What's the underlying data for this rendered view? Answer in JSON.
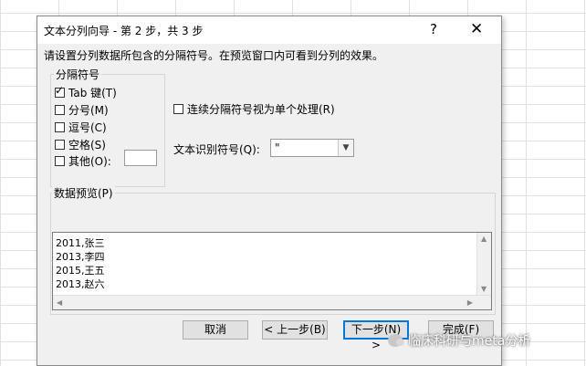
{
  "dialog": {
    "title": "文本分列向导 - 第 2 步，共 3 步",
    "help_label": "?",
    "close_label": "✕",
    "instruction": "请设置分列数据所包含的分隔符号。在预览窗口内可看到分列的效果。"
  },
  "delimiters": {
    "legend": "分隔符号",
    "items": [
      {
        "label": "Tab 键(T)",
        "checked": true
      },
      {
        "label": "分号(M)",
        "checked": false
      },
      {
        "label": "逗号(C)",
        "checked": false
      },
      {
        "label": "空格(S)",
        "checked": false
      },
      {
        "label": "其他(O):",
        "checked": false
      }
    ],
    "other_value": ""
  },
  "options": {
    "consecutive_label": "连续分隔符号视为单个处理(R)",
    "consecutive_checked": false,
    "qualifier_label": "文本识别符号(Q):",
    "qualifier_value": "\""
  },
  "preview": {
    "legend": "数据预览(P)",
    "lines": [
      "2011,张三",
      "2013,李四",
      "2015,王五",
      "2013,赵六"
    ]
  },
  "buttons": {
    "cancel": "取消",
    "back": "< 上一步(B)",
    "next": "下一步(N) >",
    "finish": "完成(F)"
  },
  "watermark": "临床科研与meta分析",
  "colors": {
    "accent": "#0078d7",
    "dialog_bg": "#f0f0f0"
  }
}
